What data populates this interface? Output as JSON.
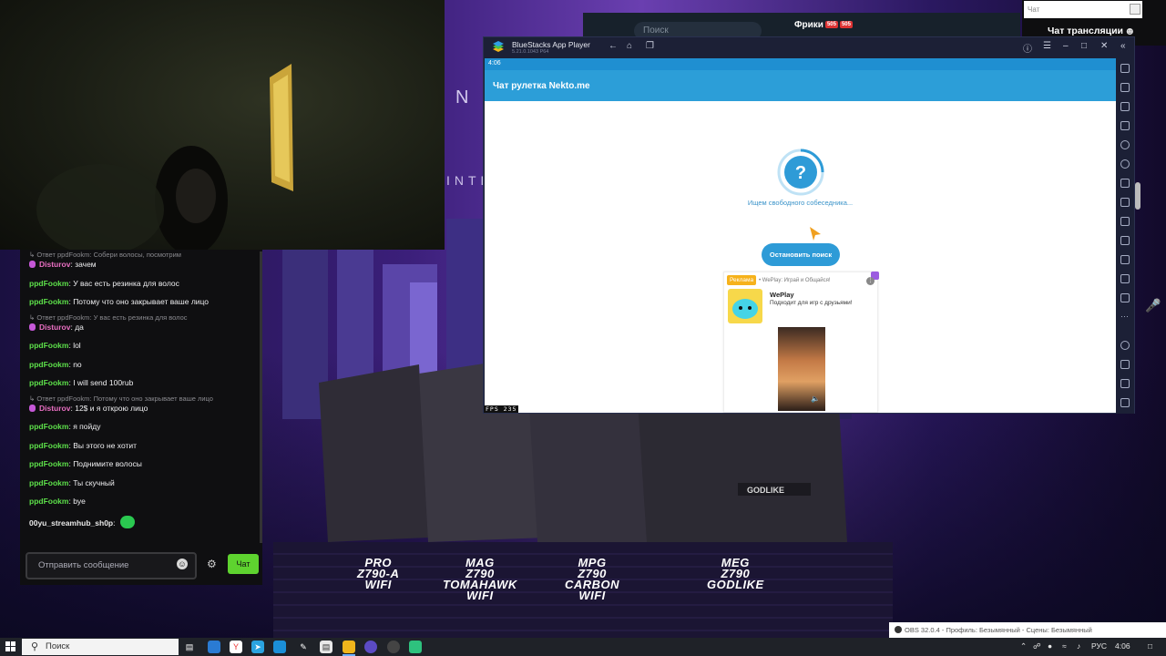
{
  "stream_chat": {
    "search_placeholder": "Чат",
    "title": "Чат трансляции"
  },
  "telegram": {
    "search_placeholder": "Поиск",
    "chat_name": "Фрики",
    "badges": [
      "505",
      "505"
    ]
  },
  "wallpaper": {
    "products": [
      {
        "line1": "PRO",
        "line2": "Z790-A",
        "line3": "WIFI"
      },
      {
        "line1": "MAG",
        "line2": "Z790",
        "line3": "TOMAHAWK",
        "line4": "WIFI"
      },
      {
        "line1": "MPG",
        "line2": "Z790",
        "line3": "CARBON",
        "line4": "WIFI"
      },
      {
        "line1": "MEG",
        "line2": "Z790",
        "line3": "GODLIKE"
      }
    ]
  },
  "twitch_chat": {
    "messages": [
      {
        "reply_to": "Ответ ppdFookm: Собери волосы, посмотрим",
        "user": "Disturov",
        "color": "pink",
        "mic": true,
        "text": "зачем"
      },
      {
        "user": "ppdFookm",
        "color": "green",
        "text": "У вас есть резинка для волос"
      },
      {
        "user": "ppdFookm",
        "color": "green",
        "text": "Потому что оно закрывает ваше лицо"
      },
      {
        "reply_to": "Ответ ppdFookm: У вас есть резинка для волос",
        "user": "Disturov",
        "color": "pink",
        "mic": true,
        "text": "да"
      },
      {
        "user": "ppdFookm",
        "color": "green",
        "text": "lol"
      },
      {
        "user": "ppdFookm",
        "color": "green",
        "text": "no"
      },
      {
        "user": "ppdFookm",
        "color": "green",
        "text": "I will send 100rub"
      },
      {
        "reply_to": "Ответ ppdFookm: Потому что оно закрывает ваше лицо",
        "user": "Disturov",
        "color": "pink",
        "mic": true,
        "text": "12$ и я открою лицо"
      },
      {
        "user": "ppdFookm",
        "color": "green",
        "text": "я пойду"
      },
      {
        "user": "ppdFookm",
        "color": "green",
        "text": "Вы этого не хотит"
      },
      {
        "user": "ppdFookm",
        "color": "green",
        "text": "Поднимите волосы"
      },
      {
        "user": "ppdFookm",
        "color": "green",
        "text": "Ты скучный"
      },
      {
        "user": "ppdFookm",
        "color": "green",
        "text": "bye"
      },
      {
        "user": "00yu_streamhub_sh0p",
        "color": "white",
        "text": "",
        "emote": true
      }
    ],
    "input_placeholder": "Отправить сообщение",
    "send_label": "Чат"
  },
  "bluestacks": {
    "title": "BlueStacks App Player",
    "version": "5.21.0.1043  P64",
    "status_time": "4:06",
    "app_title": "Чат рулетка Nekto.me",
    "searching_text": "Ищем свободного собеседника...",
    "stop_button": "Остановить поиск",
    "ad": {
      "badge": "Реклама",
      "source": "• WePlay: Играй и Общайся!",
      "app_name": "WePlay",
      "description": "Подходит для игр с друзьями!"
    },
    "fps_label": "FPS",
    "fps_value": "235"
  },
  "obs_toast": "OBS 32.0.4 - Профиль: Безымянный - Сцены: Безымянный",
  "taskbar": {
    "search_placeholder": "Поиск",
    "language": "РУС",
    "clock": "4:06"
  },
  "colors": {
    "bluestacks_accent": "#2c9ed8",
    "twitch_green": "#5de04a",
    "twitch_pink": "#e96fc2",
    "send_button": "#5ed32f"
  }
}
